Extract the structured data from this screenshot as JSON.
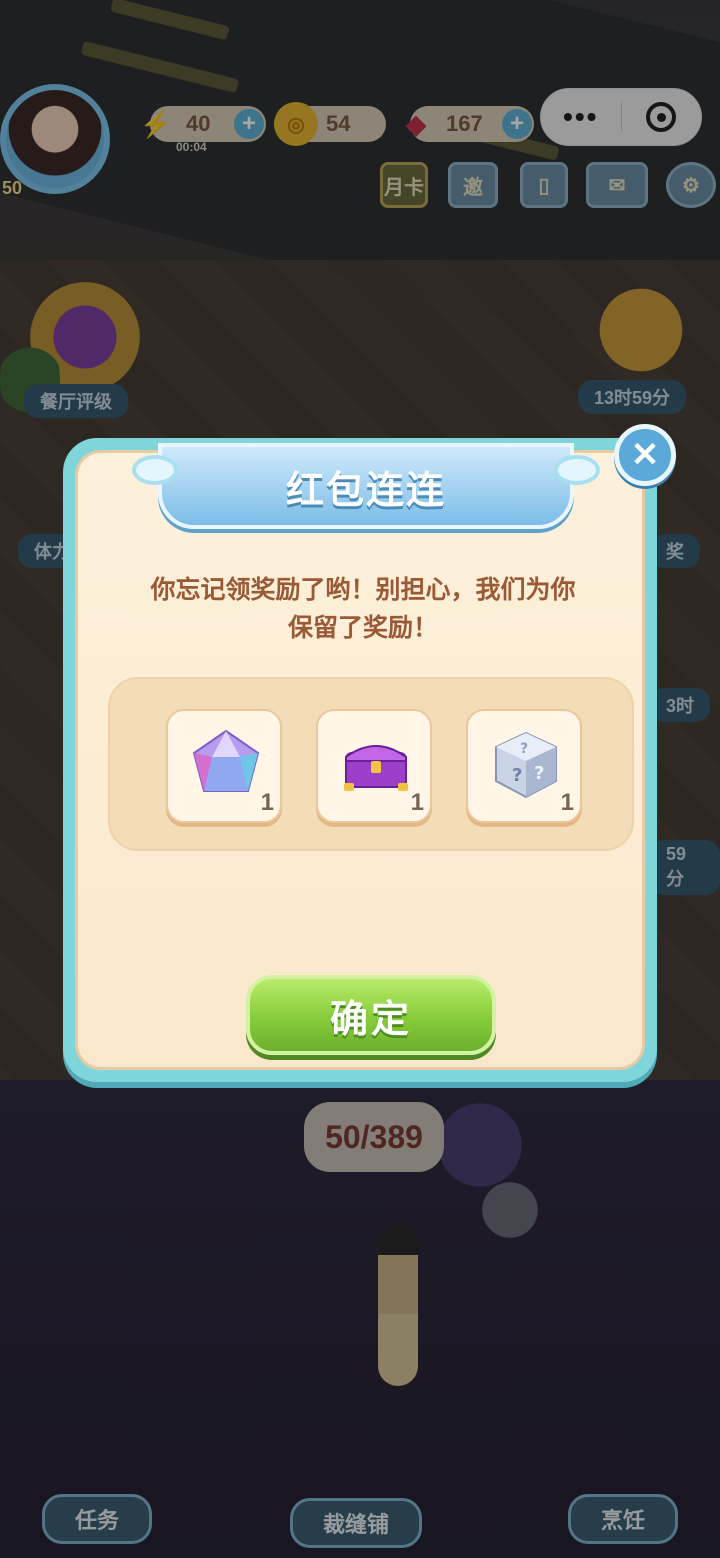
{
  "hud": {
    "level": "50",
    "energy": {
      "value": "40",
      "timer": "00:04"
    },
    "coins": "54",
    "gems": "167",
    "monthly_card_label": "月卡",
    "invite_label": "邀"
  },
  "scene": {
    "restaurant_rating_label": "餐厅评级",
    "timer_1": "13时59分",
    "stamina_label": "体力",
    "reward_label_partial": "奖",
    "timer_2_partial": "3时",
    "timer_3_partial": "59分",
    "progress_counter": "50/389"
  },
  "bottom_nav": {
    "tasks_label": "任务",
    "tailor_label": "裁缝铺",
    "cooking_label": "烹饪"
  },
  "modal": {
    "title": "红包连连",
    "message_line1": "你忘记领奖励了哟！别担心，我们为你",
    "message_line2": "保留了奖励！",
    "rewards": [
      {
        "icon": "gem-icon",
        "count": "1"
      },
      {
        "icon": "purple-chest-icon",
        "count": "1"
      },
      {
        "icon": "mystery-box-icon",
        "count": "1"
      }
    ],
    "confirm_label": "确定"
  },
  "colors": {
    "modal_border": "#7fd6da",
    "modal_bg": "#fdf1dc",
    "title_ribbon": "#7bbde7",
    "message_text": "#9b5a36",
    "confirm_green": "#86cc3a"
  }
}
